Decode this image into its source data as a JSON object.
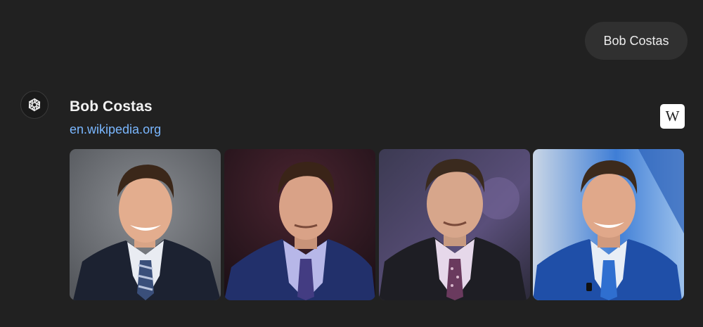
{
  "user_message": {
    "text": "Bob Costas"
  },
  "assistant": {
    "avatar_icon": "openai-logo-icon"
  },
  "result": {
    "title": "Bob Costas",
    "source": "en.wikipedia.org",
    "source_badge": "W",
    "source_icon": "wikipedia-icon"
  },
  "images": [
    {
      "subject": "portrait-gray-backdrop"
    },
    {
      "subject": "portrait-dark-red-backdrop"
    },
    {
      "subject": "portrait-purple-backdrop"
    },
    {
      "subject": "portrait-blue-studio-backdrop"
    }
  ],
  "colors": {
    "background": "#212121",
    "bubble": "#303030",
    "link": "#7ab7ff"
  }
}
